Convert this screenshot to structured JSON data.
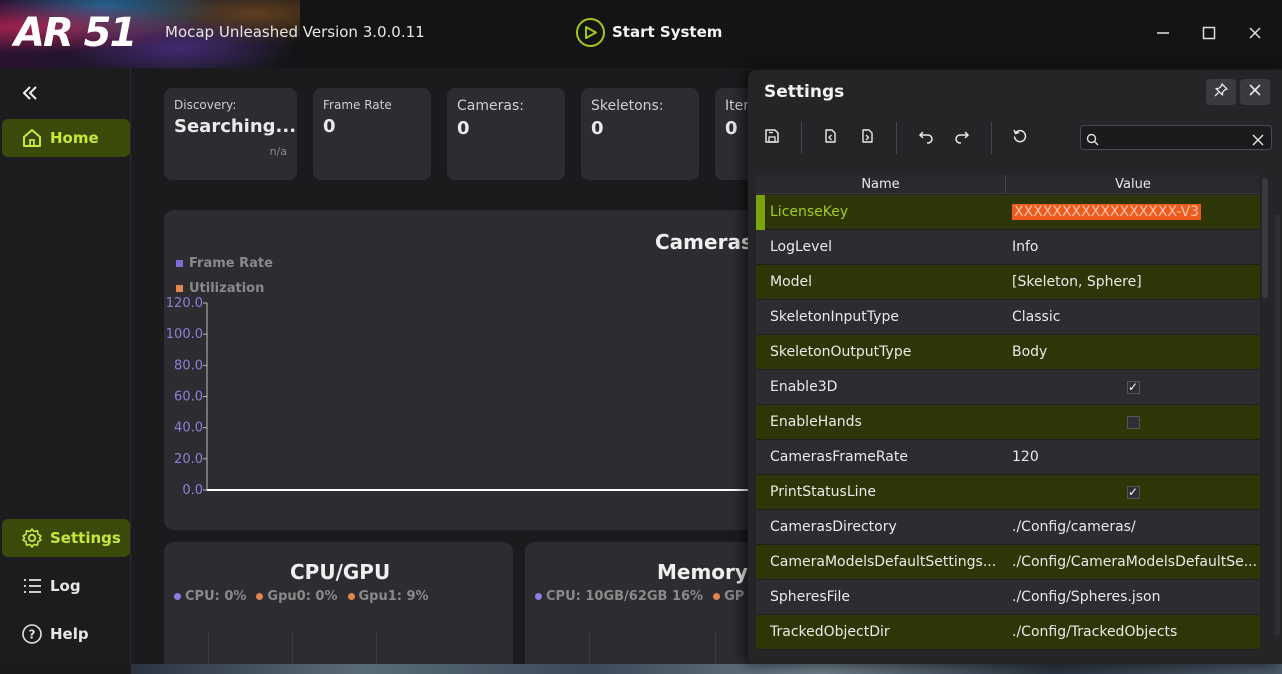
{
  "app": {
    "logo_text": "AR 51",
    "title": "Mocap Unleashed Version 3.0.0.11",
    "start_label": "Start System"
  },
  "window_controls": [
    "minimize",
    "maximize",
    "close"
  ],
  "sidebar": {
    "items": [
      {
        "label": "Home",
        "icon": "home-icon",
        "active": true
      },
      {
        "label": "Settings",
        "icon": "gear-icon",
        "active": true
      },
      {
        "label": "Log",
        "icon": "list-icon",
        "active": false
      },
      {
        "label": "Help",
        "icon": "help-icon",
        "active": false
      }
    ]
  },
  "stats": [
    {
      "label": "Discovery:",
      "value": "Searching...",
      "sub": "n/a"
    },
    {
      "label": "Frame Rate",
      "value": "0"
    },
    {
      "label": "Cameras:",
      "value": "0"
    },
    {
      "label": "Skeletons:",
      "value": "0"
    },
    {
      "label": "Iter",
      "value": "0"
    }
  ],
  "cameras_chart": {
    "title": "Cameras",
    "legend": [
      {
        "label": "Frame Rate",
        "color": "#7b6fd6"
      },
      {
        "label": "Utilization",
        "color": "#e0874f"
      }
    ],
    "ticks": [
      "120.0",
      "100.0",
      "80.0",
      "60.0",
      "40.0",
      "20.0",
      "0.0"
    ]
  },
  "chart_data": {
    "type": "line",
    "title": "Cameras",
    "series": [
      {
        "name": "Frame Rate",
        "values": [
          0
        ]
      },
      {
        "name": "Utilization",
        "values": [
          0
        ]
      }
    ],
    "y_ticks": [
      120,
      100,
      80,
      60,
      40,
      20,
      0
    ],
    "ylim": [
      0,
      120
    ],
    "legend_position": "top-left"
  },
  "cpu_panel": {
    "title": "CPU/GPU",
    "legend": [
      {
        "label": "CPU: 0%",
        "color": "#8a7fe0"
      },
      {
        "label": "Gpu0: 0%",
        "color": "#e0874f"
      },
      {
        "label": "Gpu1: 9%",
        "color": "#e0874f"
      }
    ]
  },
  "memory_panel": {
    "title": "Memory",
    "legend": [
      {
        "label": "CPU: 10GB/62GB 16%",
        "color": "#8a7fe0"
      },
      {
        "label": "GP",
        "color": "#e0874f"
      }
    ]
  },
  "settings": {
    "title": "Settings",
    "search_value": "",
    "columns": {
      "name": "Name",
      "value": "Value"
    },
    "rows": [
      {
        "name": "LicenseKey",
        "value": "XXXXXXXXXXXXXXXXX-V3",
        "type": "license",
        "selected": true
      },
      {
        "name": "LogLevel",
        "value": "Info",
        "type": "text"
      },
      {
        "name": "Model",
        "value": "[Skeleton, Sphere]",
        "type": "text"
      },
      {
        "name": "SkeletonInputType",
        "value": "Classic",
        "type": "text"
      },
      {
        "name": "SkeletonOutputType",
        "value": "Body",
        "type": "text"
      },
      {
        "name": "Enable3D",
        "value": "true",
        "type": "bool"
      },
      {
        "name": "EnableHands",
        "value": "false",
        "type": "bool"
      },
      {
        "name": "CamerasFrameRate",
        "value": "120",
        "type": "text"
      },
      {
        "name": "PrintStatusLine",
        "value": "true",
        "type": "bool"
      },
      {
        "name": "CamerasDirectory",
        "value": "./Config/cameras/",
        "type": "text"
      },
      {
        "name": "CameraModelsDefaultSettings...",
        "value": "./Config/CameraModelsDefaultSe...",
        "type": "text"
      },
      {
        "name": "SpheresFile",
        "value": "./Config/Spheres.json",
        "type": "text"
      },
      {
        "name": "TrackedObjectDir",
        "value": "./Config/TrackedObjects",
        "type": "text"
      }
    ]
  },
  "colors": {
    "accent": "#a4c81a",
    "active_nav_bg": "#3a4a0a",
    "olive_row": "#2e3507",
    "license_highlight": "#ef5a1e"
  }
}
